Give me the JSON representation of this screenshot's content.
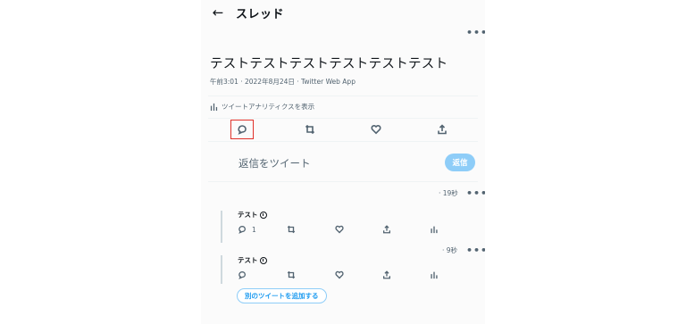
{
  "header": {
    "back_icon": "arrow-left-icon",
    "title": "スレッド",
    "more_label": "•••"
  },
  "tweet": {
    "text": "テストテストテストテストテストテスト",
    "meta": "午前3:01 · 2022年8月24日 · Twitter Web App",
    "analytics_label": "ツイートアナリティクスを表示",
    "actions": [
      "reply-icon",
      "retweet-icon",
      "like-icon",
      "share-icon"
    ]
  },
  "composer": {
    "placeholder": "返信をツイート",
    "reply_button": "返信"
  },
  "thread": [
    {
      "name": "テスト",
      "time": "· 19秒",
      "reply_count": "1"
    },
    {
      "name": "テスト",
      "time": "· 9秒",
      "reply_count": ""
    }
  ],
  "add_tweet_button": "別のツイートを追加する",
  "colors": {
    "accent": "#1d9bf0",
    "reply_button_bg": "#8ecdf8",
    "highlight": "#e0312a"
  }
}
